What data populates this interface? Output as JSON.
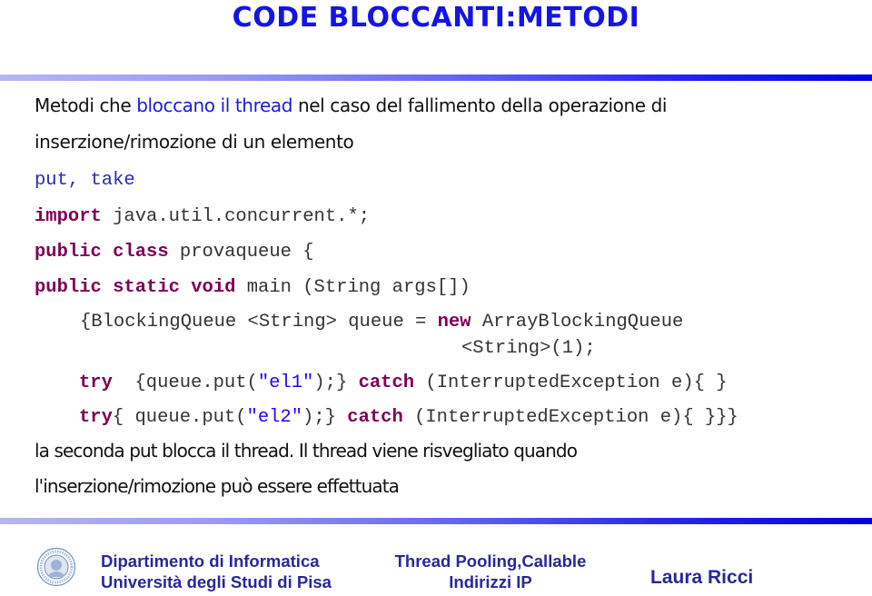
{
  "slide": {
    "title": "CODE BLOCCANTI:METODI",
    "intro": {
      "part1": "Metodi che ",
      "highlight": "bloccano il thread",
      "part2": " nel caso del fallimento della operazione di",
      "line2": "inserzione/rimozione di un elemento"
    },
    "methods": "put, take",
    "code": {
      "line1": {
        "kw": "import",
        "rest": " java.util.concurrent.*;"
      },
      "line2": {
        "kw": "public class",
        "rest": " provaqueue {"
      },
      "line3": {
        "kw": "public static void",
        "rest": " main (String args[])"
      },
      "line4": {
        "pre": "{BlockingQueue <String> queue = ",
        "kw": "new",
        "rest": " ArrayBlockingQueue"
      },
      "line5": "<String>(1);",
      "line6": {
        "kw1": "try",
        "a": "  {queue.put(",
        "str": "\"el1\"",
        "b": ");} ",
        "kw2": "catch",
        "c": " (InterruptedException e){ }"
      },
      "line7": {
        "kw1": "try",
        "a": "{ queue.put(",
        "str": "\"el2\"",
        "b": ");} ",
        "kw2": "catch",
        "c": " (InterruptedException e){ }}}"
      }
    },
    "conclusion": {
      "line1": "la seconda put blocca il thread. Il thread viene risvegliato quando",
      "line2": "l'inserzione/rimozione può essere effettuata"
    }
  },
  "footer": {
    "logo": "university-seal-icon",
    "department": "Dipartimento di Informatica",
    "university": "Università degli Studi di Pisa",
    "topic_line1": "Thread Pooling,Callable",
    "topic_line2": "Indirizzi IP",
    "author": "Laura Ricci"
  },
  "colors": {
    "title": "#1414e6",
    "highlight": "#1a1ae0",
    "keyword": "#7f0055",
    "string": "#2a00ff",
    "footer": "#28289a"
  }
}
